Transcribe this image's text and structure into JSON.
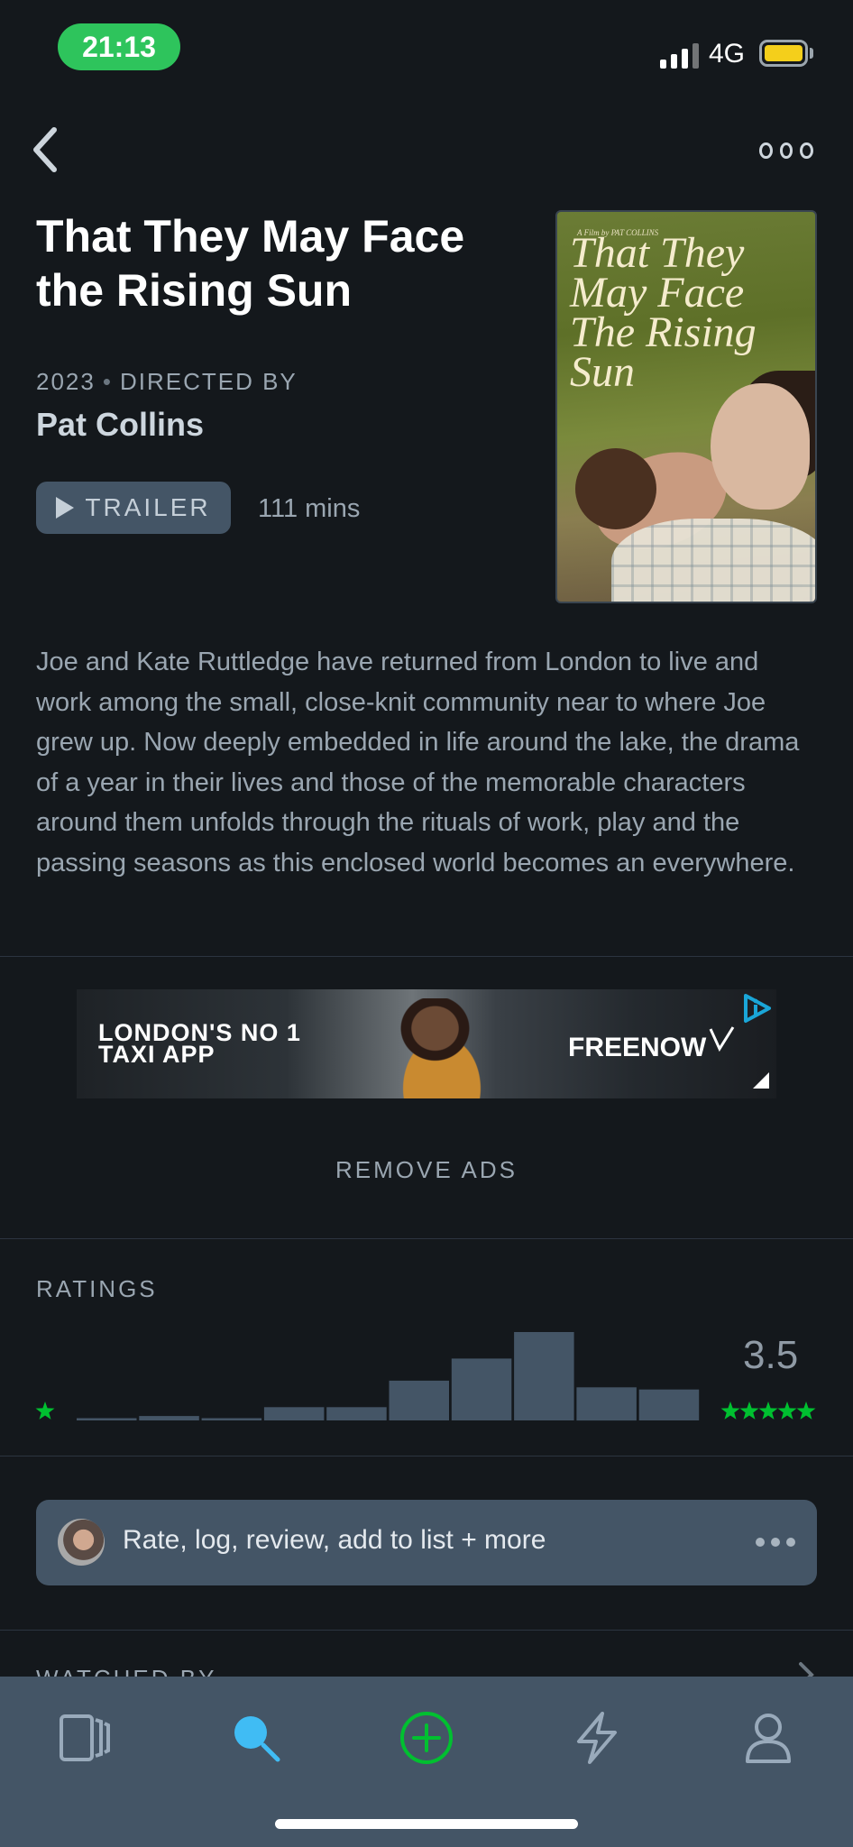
{
  "status_bar": {
    "time": "21:13",
    "network": "4G"
  },
  "film": {
    "title": "That They May Face the Rising Sun",
    "year": "2023",
    "directed_by_label": "DIRECTED BY",
    "director": "Pat Collins",
    "trailer_label": "TRAILER",
    "runtime": "111 mins",
    "poster": {
      "credit": "A Film by PAT COLLINS",
      "title": "That They May Face The Rising Sun"
    },
    "synopsis": "Joe and Kate Ruttledge have returned from London to live and work among the small, close-knit community near to where Joe grew up. Now deeply embedded in life around the lake, the drama of a year in their lives and those of the memorable characters around them unfolds through the rituals of work, play and the passing seasons as this enclosed world becomes an everywhere."
  },
  "ad": {
    "headline_line1": "LONDON'S NO 1",
    "headline_line2": "TAXI APP",
    "brand": "FREENOW"
  },
  "remove_ads_label": "REMOVE ADS",
  "ratings": {
    "label": "RATINGS",
    "average": "3.5",
    "histogram": [
      1,
      2,
      1,
      6,
      6,
      18,
      28,
      40,
      15,
      14
    ],
    "accent_color": "#00c030"
  },
  "action_bar": {
    "label": "Rate, log, review, add to list + more"
  },
  "watched_by_label": "WATCHED BY",
  "tab_bar": {
    "items": [
      {
        "icon": "films-icon"
      },
      {
        "icon": "search-icon",
        "active": true
      },
      {
        "icon": "add-icon"
      },
      {
        "icon": "activity-icon"
      },
      {
        "icon": "profile-icon"
      }
    ]
  },
  "colors": {
    "background": "#14181c",
    "surface": "#445566",
    "search_active": "#40bcf4",
    "add_green": "#00c030"
  }
}
